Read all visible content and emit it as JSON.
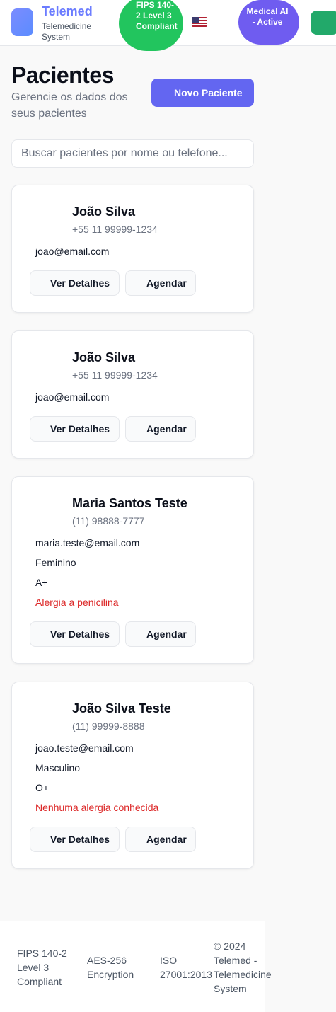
{
  "header": {
    "brand": "Telemed",
    "brand_sub": "Telemedicine System",
    "fips_badge": "FIPS 140-2 Level 3 Compliant",
    "flag_icon": "us-flag-icon",
    "ai_badge": "Medical AI - Active"
  },
  "page": {
    "title": "Pacientes",
    "subtitle": "Gerencie os dados dos seus pacientes",
    "new_button": "Novo Paciente",
    "search_placeholder": "Buscar pacientes por nome ou telefone..."
  },
  "patients": [
    {
      "name": "João Silva",
      "phone": "+55 11 99999-1234",
      "email": "joao@email.com"
    },
    {
      "name": "João Silva",
      "phone": "+55 11 99999-1234",
      "email": "joao@email.com"
    },
    {
      "name": "Maria Santos Teste",
      "phone": "(11) 98888-7777",
      "email": "maria.teste@email.com",
      "gender": "Feminino",
      "blood": "A+",
      "allergy": "Alergia a penicilina"
    },
    {
      "name": "João Silva Teste",
      "phone": "(11) 99999-8888",
      "email": "joao.teste@email.com",
      "gender": "Masculino",
      "blood": "O+",
      "allergy": "Nenhuma alergia conhecida"
    }
  ],
  "buttons": {
    "details": "Ver Detalhes",
    "schedule": "Agendar"
  },
  "footer": {
    "fips": "FIPS 140-2 Level 3 Compliant",
    "aes": "AES-256 Encryption",
    "iso": "ISO 27001:2013",
    "copyright": "© 2024 Telemed - Telemedicine System"
  },
  "colors": {
    "accent": "#6366f1",
    "fips_green": "#22c55e",
    "ai_purple": "#6f5cf0",
    "allergy_red": "#dc2626"
  }
}
